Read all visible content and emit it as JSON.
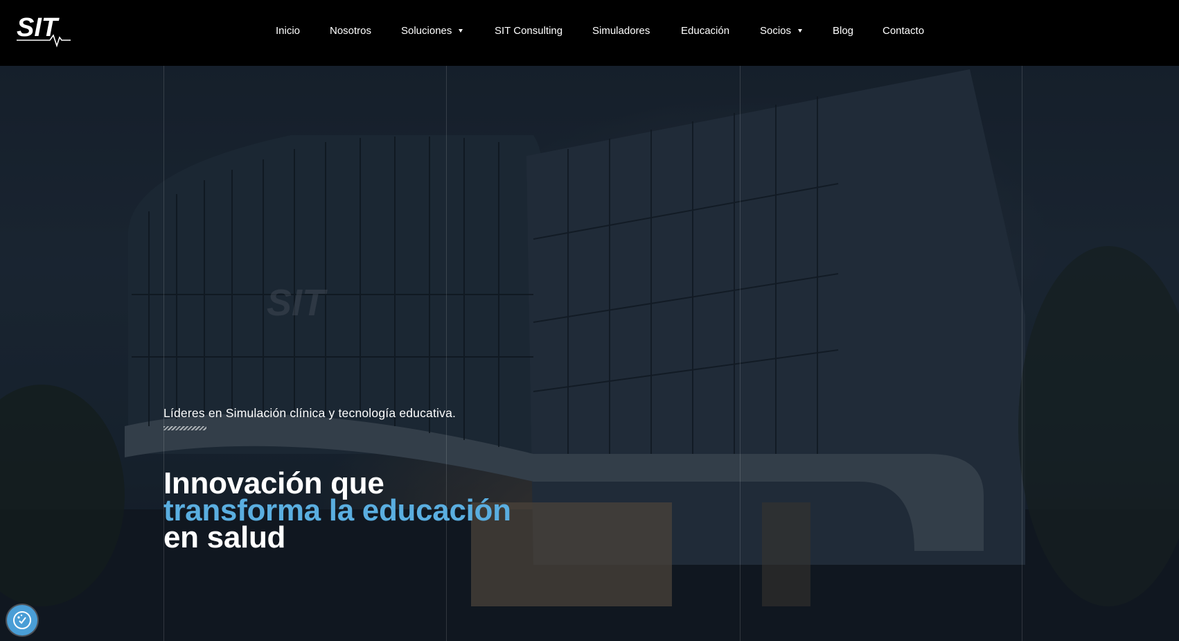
{
  "header": {
    "logo_text": "SIT",
    "nav": [
      {
        "label": "Inicio"
      },
      {
        "label": "Nosotros"
      },
      {
        "label": "Soluciones",
        "has_dropdown": true
      },
      {
        "label": "SIT Consulting"
      },
      {
        "label": "Simuladores"
      },
      {
        "label": "Educación"
      },
      {
        "label": "Socios",
        "has_dropdown": true
      },
      {
        "label": "Blog"
      },
      {
        "label": "Contacto"
      }
    ]
  },
  "hero": {
    "tagline": "Líderes en Simulación clínica y tecnología educativa.",
    "headline_line1": "Innovación que",
    "headline_line2": "transforma la educación",
    "headline_line3": "en salud"
  },
  "colors": {
    "header_bg": "#000000",
    "accent": "#5aaee0",
    "cookie_button": "#4a9ed6"
  },
  "icons": {
    "caret": "caret-down-icon",
    "cookie": "cookie-consent-icon"
  }
}
